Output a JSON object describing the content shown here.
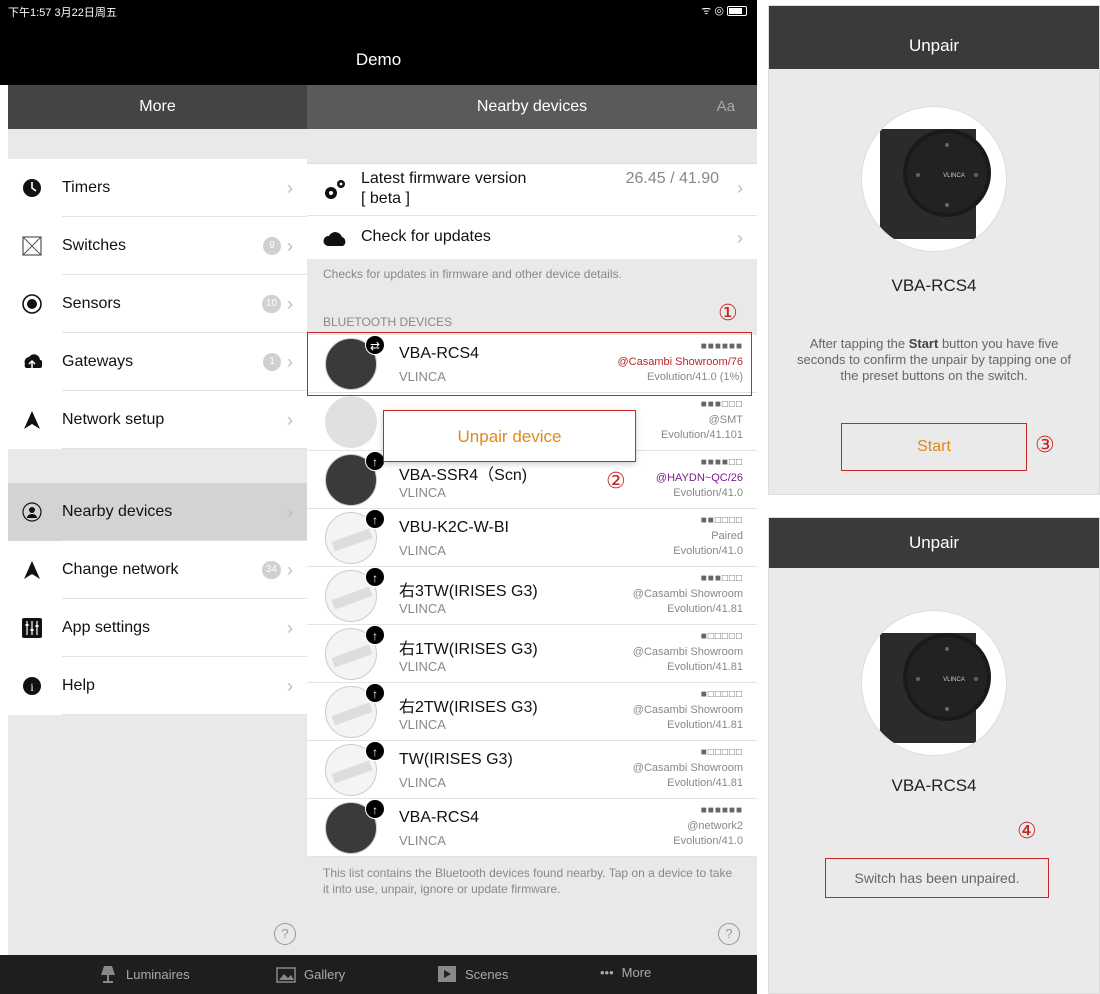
{
  "status": {
    "time": "下午1:57  3月22日周五",
    "icons": "ᯤ ◎"
  },
  "app": {
    "title": "Demo"
  },
  "left": {
    "header": "More",
    "items": [
      {
        "label": "Timers",
        "icon": "clock-icon",
        "badge": ""
      },
      {
        "label": "Switches",
        "icon": "switch-icon",
        "badge": "9"
      },
      {
        "label": "Sensors",
        "icon": "sensor-icon",
        "badge": "10"
      },
      {
        "label": "Gateways",
        "icon": "gateway-icon",
        "badge": "1"
      },
      {
        "label": "Network setup",
        "icon": "network-icon",
        "badge": ""
      }
    ],
    "items2": [
      {
        "label": "Nearby devices",
        "icon": "nearby-icon",
        "badge": ""
      },
      {
        "label": "Change network",
        "icon": "change-network-icon",
        "badge": "34"
      },
      {
        "label": "App settings",
        "icon": "settings-icon",
        "badge": ""
      },
      {
        "label": "Help",
        "icon": "help-icon",
        "badge": ""
      }
    ],
    "help_q": "?"
  },
  "right": {
    "header": "Nearby devices",
    "aa": "Aa",
    "firmware": {
      "line1": "Latest firmware version",
      "line2": "[ beta ]",
      "value": "26.45 / 41.90"
    },
    "check": "Check for updates",
    "note": "Checks for updates in firmware and other device details.",
    "section": "BLUETOOTH DEVICES",
    "devices": [
      {
        "name": "VBA-RCS4",
        "mfr": "VLINCA",
        "sig": "■■■■■■",
        "r1": "@Casambi Showroom/76",
        "r2": "Evolution/41.0 (1%)",
        "badge": "⇄"
      },
      {
        "name": "",
        "mfr": "",
        "sig": "■■■□□□",
        "r1": "@SMT",
        "r2": "Evolution/41.101",
        "badge": ""
      },
      {
        "name": "VBA-SSR4（Scn)",
        "mfr": "VLINCA",
        "sig": "■■■■□□",
        "r1": "@HAYDN~QC/26",
        "r2": "Evolution/41.0",
        "badge": "↑"
      },
      {
        "name": "VBU-K2C-W-BI",
        "mfr": "VLINCA",
        "sig": "■■□□□□",
        "r1": "Paired",
        "r2": "Evolution/41.0",
        "badge": "↑"
      },
      {
        "name": "右3TW(IRISES G3)",
        "mfr": "VLINCA",
        "sig": "■■■□□□",
        "r1": "@Casambi Showroom",
        "r2": "Evolution/41.81",
        "badge": "↑"
      },
      {
        "name": "右1TW(IRISES G3)",
        "mfr": "VLINCA",
        "sig": "■□□□□□",
        "r1": "@Casambi Showroom",
        "r2": "Evolution/41.81",
        "badge": "↑"
      },
      {
        "name": "右2TW(IRISES G3)",
        "mfr": "VLINCA",
        "sig": "■□□□□□",
        "r1": "@Casambi Showroom",
        "r2": "Evolution/41.81",
        "badge": "↑"
      },
      {
        "name": "TW(IRISES G3)",
        "mfr": "VLINCA",
        "sig": "■□□□□□",
        "r1": "@Casambi Showroom",
        "r2": "Evolution/41.81",
        "badge": "↑"
      },
      {
        "name": "VBA-RCS4",
        "mfr": "VLINCA",
        "sig": "■■■■■■",
        "r1": "@network2",
        "r2": "Evolution/41.0",
        "badge": "↑"
      }
    ],
    "footnote": "This list contains the Bluetooth devices found nearby. Tap on a device to take it into use, unpair, ignore or update firmware.",
    "help_q": "?"
  },
  "popup": {
    "label": "Unpair device"
  },
  "markers": {
    "m1": "①",
    "m2": "②",
    "m3": "③",
    "m4": "④"
  },
  "tabs": {
    "luminaires": "Luminaires",
    "gallery": "Gallery",
    "scenes": "Scenes",
    "more": "More",
    "more_dots": "•••"
  },
  "panel1": {
    "title": "Unpair",
    "name": "VBA-RCS4",
    "text_pre": "After tapping the ",
    "text_bold": "Start",
    "text_post": " button you have five seconds to confirm the unpair by tapping one of the preset buttons on the switch.",
    "start": "Start"
  },
  "panel2": {
    "title": "Unpair",
    "name": "VBA-RCS4",
    "message": "Switch has been unpaired."
  },
  "device_brand": "VLINCA",
  "colors": {
    "accent": "#e08a1a",
    "highlight": "#c62828"
  }
}
